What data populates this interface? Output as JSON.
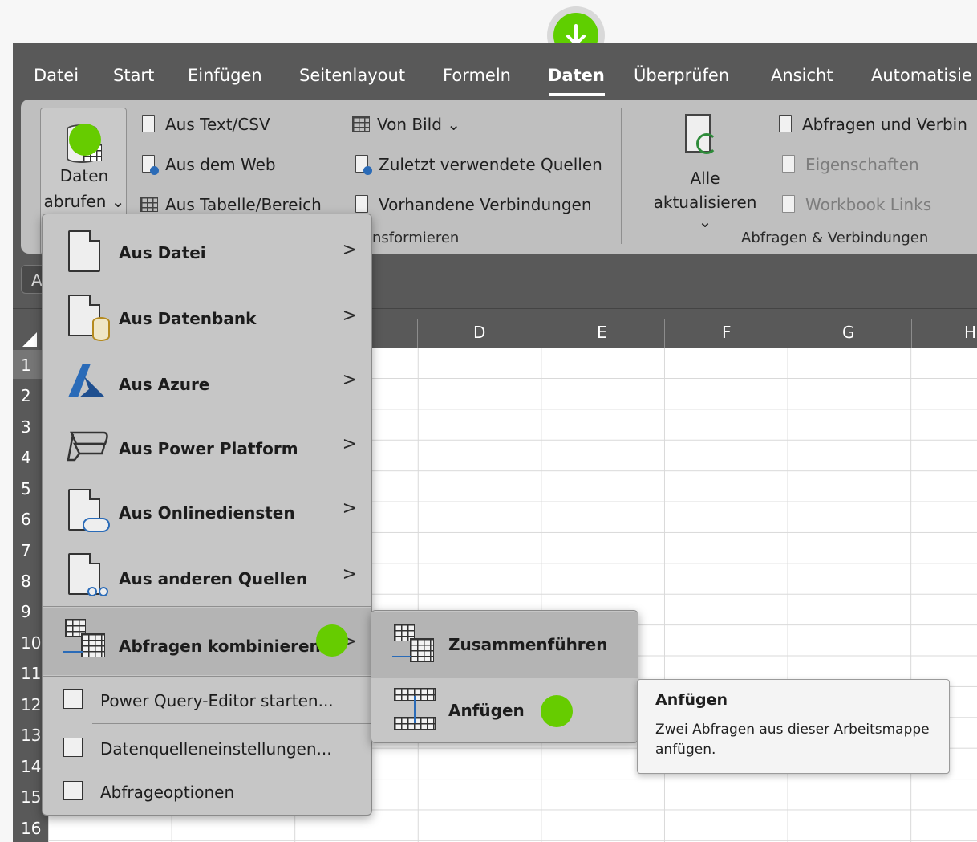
{
  "tabs": [
    "Datei",
    "Start",
    "Einfügen",
    "Seitenlayout",
    "Formeln",
    "Daten",
    "Überprüfen",
    "Ansicht",
    "Automatisie"
  ],
  "ribbon": {
    "get_data_line1": "Daten",
    "get_data_line2": "abrufen ⌄",
    "text_csv": "Aus Text/CSV",
    "web": "Aus dem Web",
    "table_range": "Aus Tabelle/Bereich",
    "from_image": "Von Bild ⌄",
    "recent_sources": "Zuletzt verwendete Quellen",
    "existing_connections": "Vorhandene Verbindungen",
    "group_transform": "nsformieren",
    "refresh_line1": "Alle",
    "refresh_line2": "aktualisieren ⌄",
    "queries_connections": "Abfragen und Verbin",
    "properties": "Eigenschaften",
    "workbook_links": "Workbook Links",
    "group_queries": "Abfragen & Verbindungen"
  },
  "namebox": "A",
  "columns": [
    "D",
    "E",
    "F",
    "G",
    "H"
  ],
  "rows": [
    "1",
    "2",
    "3",
    "4",
    "5",
    "6",
    "7",
    "8",
    "9",
    "10",
    "11",
    "12",
    "13",
    "14",
    "15",
    "16"
  ],
  "menu": {
    "items": [
      {
        "label": "Aus Datei",
        "chevron": ">"
      },
      {
        "label": "Aus Datenbank",
        "chevron": ">"
      },
      {
        "label": "Aus Azure",
        "chevron": ">"
      },
      {
        "label": "Aus Power Platform",
        "chevron": ">"
      },
      {
        "label": "Aus Onlinediensten",
        "chevron": ">"
      },
      {
        "label": "Aus anderen Quellen",
        "chevron": ">"
      },
      {
        "label": "Abfragen kombinieren",
        "chevron": ">"
      }
    ],
    "power_query": "Power Query-Editor starten...",
    "data_source_settings": "Datenquelleneinstellungen...",
    "query_options": "Abfrageoptionen"
  },
  "submenu": {
    "merge": "Zusammenführen",
    "append": "Anfügen"
  },
  "tooltip": {
    "title": "Anfügen",
    "body": "Zwei Abfragen aus dieser Arbeitsmappe anfügen."
  },
  "colors": {
    "marker": "#66cc00",
    "ribbon": "#bfbfbf",
    "menu": "#c6c6c6"
  }
}
